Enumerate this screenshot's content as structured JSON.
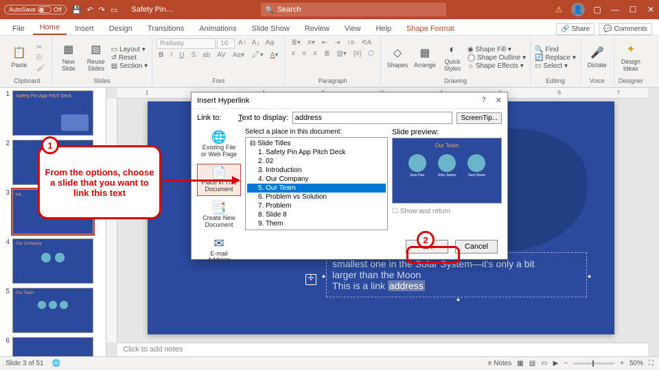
{
  "titlebar": {
    "autosave_label": "AutoSave",
    "autosave_state": "Off",
    "doc_name": "Safety Pin…",
    "search_placeholder": "Search"
  },
  "tabs": {
    "file": "File",
    "home": "Home",
    "insert": "Insert",
    "design": "Design",
    "transitions": "Transitions",
    "animations": "Animations",
    "slideshow": "Slide Show",
    "review": "Review",
    "view": "View",
    "help": "Help",
    "shapeformat": "Shape Format",
    "share": "Share",
    "comments": "Comments"
  },
  "ribbon": {
    "clipboard": {
      "paste": "Paste",
      "label": "Clipboard"
    },
    "slides": {
      "new": "New Slide",
      "reuse": "Reuse Slides",
      "layout": "Layout",
      "reset": "Reset",
      "section": "Section",
      "label": "Slides"
    },
    "font": {
      "name": "Railway",
      "size": "16",
      "label": "Font"
    },
    "paragraph": {
      "label": "Paragraph"
    },
    "drawing": {
      "shapes": "Shapes",
      "arrange": "Arrange",
      "quick": "Quick Styles",
      "fill": "Shape Fill",
      "outline": "Shape Outline",
      "effects": "Shape Effects",
      "label": "Drawing"
    },
    "editing": {
      "find": "Find",
      "replace": "Replace",
      "select": "Select",
      "label": "Editing"
    },
    "voice": {
      "dictate": "Dictate",
      "label": "Voice"
    },
    "designer": {
      "ideas": "Design Ideas",
      "label": "Designer"
    }
  },
  "thumbs": {
    "t1": "Safety Pin App Pitch Deck",
    "t3": "Int…",
    "t4": "Our Company",
    "t5": "Our Team"
  },
  "slide": {
    "line1": "smallest one in the Solar System—it's only a bit",
    "line2": "larger than the Moon",
    "line3_a": "This is a link ",
    "line3_b": "address"
  },
  "notes": {
    "placeholder": "Click to add notes"
  },
  "status": {
    "left": "Slide 3 of 51",
    "lang": "English",
    "notes": "Notes",
    "zoom": "50%"
  },
  "dialog": {
    "title": "Insert Hyperlink",
    "linkto": "Link to:",
    "text_to_display": "Text to display:",
    "display_value": "address",
    "screentip": "ScreenTip...",
    "opts": {
      "existing": "Existing File or Web Page",
      "place": "Place in This Document",
      "createnew": "Create New Document",
      "email": "E-mail Address"
    },
    "select_label": "Select a place in this document:",
    "tree": {
      "root": "Slide Titles",
      "i1": "1. Safety Pin App Pitch Deck",
      "i2": "2. 02",
      "i3": "3. Introduction",
      "i4": "4. Our Company",
      "i5": "5. Our Team",
      "i6": "6. Problem vs Solution",
      "i7": "7. Problem",
      "i8": "8. Slide 8",
      "i9": "9. Them"
    },
    "preview_label": "Slide preview:",
    "preview_title": "Our Team",
    "names": [
      "Jane Doe",
      "John James",
      "Sara Stone"
    ],
    "show_return": "Show and return",
    "ok": "OK",
    "cancel": "Cancel"
  },
  "callout": {
    "c1": "From the options, choose a slide that you want to link this text",
    "b1": "1",
    "b2": "2"
  },
  "ruler": [
    "1",
    "1",
    "2",
    "3",
    "4",
    "5",
    "6",
    "7"
  ]
}
